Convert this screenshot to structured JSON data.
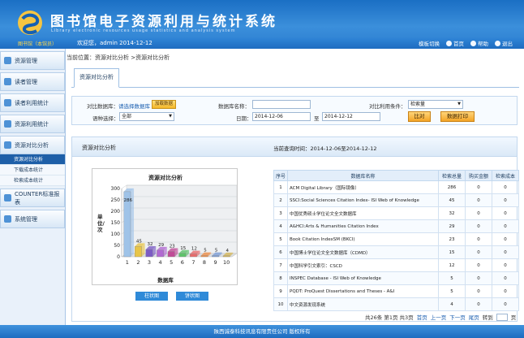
{
  "header": {
    "title": "图书馆电子资源利用与统计系统",
    "subtitle": "Library electronic resources usage statistics and analysis system",
    "user_role": "图书馆（本馆员）",
    "welcome": "欢迎您，admin   2014-12-12",
    "links": [
      {
        "label": "模板切换",
        "icon": "template-icon"
      },
      {
        "label": "首页",
        "icon": "home-icon"
      },
      {
        "label": "帮助",
        "icon": "help-icon"
      },
      {
        "label": "退出",
        "icon": "exit-icon"
      }
    ]
  },
  "sidebar": {
    "items": [
      {
        "label": "资源管理",
        "icon": "resource-icon"
      },
      {
        "label": "读者管理",
        "icon": "reader-icon"
      },
      {
        "label": "读者利用统计",
        "icon": "reader-stats-icon"
      },
      {
        "label": "资源利用统计",
        "icon": "resource-stats-icon"
      },
      {
        "label": "资源对比分析",
        "icon": "compare-icon"
      },
      {
        "label": "COUNTER标准报表",
        "icon": "report-icon"
      },
      {
        "label": "系统管理",
        "icon": "system-icon"
      }
    ],
    "sub_items": [
      "资源对比分析",
      "下载成本统计",
      "检索成本统计"
    ]
  },
  "breadcrumb": "当前位置：资源对比分析 >资源对比分析",
  "tab": "资源对比分析",
  "filter": {
    "db_label": "对比数据库：",
    "db_link": "请选择数据库",
    "db_button": "加载数据",
    "dbname_label": "数据库名称：",
    "condition_label": "对比利用条件：",
    "condition_value": "检索量",
    "lang_label": "语种选择：",
    "lang_value": "全部",
    "date_label": "日期：",
    "date_from": "2014-12-06",
    "date_to_label": "至",
    "date_to": "2014-12-12",
    "compare_button": "比对",
    "print_button": "数据打印"
  },
  "panel": {
    "title": "资源对比分析",
    "query_time": "当前查询时间：2014-12-06至2014-12-12",
    "bar_button": "柱状图",
    "pie_button": "饼状图"
  },
  "chart_data": {
    "type": "bar",
    "title": "资源对比分析",
    "xlabel": "数据库",
    "ylabel": "单位/次",
    "categories": [
      "1",
      "2",
      "3",
      "4",
      "5",
      "6",
      "7",
      "8",
      "9",
      "10"
    ],
    "values": [
      286,
      45,
      32,
      29,
      23,
      15,
      12,
      5,
      5,
      4
    ],
    "ylim": [
      0,
      300
    ],
    "yticks": [
      0,
      50,
      100,
      150,
      200,
      250,
      300
    ],
    "colors": [
      "#9fc3e8",
      "#e8c548",
      "#7c5cc4",
      "#b16ad2",
      "#c04c97",
      "#5fc36b",
      "#e86b6b",
      "#f0904a",
      "#7fa0d8",
      "#d7b85a"
    ],
    "grid": true,
    "legend": "none"
  },
  "table": {
    "headers": [
      "序号",
      "数据库名称",
      "检索总量",
      "购买金额",
      "检索成本"
    ],
    "rows": [
      [
        "1",
        "ACM Digital Library（国际镜像）",
        "286",
        "0",
        "0"
      ],
      [
        "2",
        "SSCI:Social Sciences Citation Index- ISI Web of Knowledge",
        "45",
        "0",
        "0"
      ],
      [
        "3",
        "中国优秀硕士学位论文全文数据库",
        "32",
        "0",
        "0"
      ],
      [
        "4",
        "A&HCI:Arts & Humanities Citation Index",
        "29",
        "0",
        "0"
      ],
      [
        "5",
        "Book Citation IndexSM (BKCI)",
        "23",
        "0",
        "0"
      ],
      [
        "6",
        "中国博士学位论文全文数据库（CDMD）",
        "15",
        "0",
        "0"
      ],
      [
        "7",
        "中国科学引文索引：CSCD",
        "12",
        "0",
        "0"
      ],
      [
        "8",
        "INSPEC Database - ISI Web of Knowledge",
        "5",
        "0",
        "0"
      ],
      [
        "9",
        "PQDT: ProQuest Dissertations and Theses - A&I",
        "5",
        "0",
        "0"
      ],
      [
        "10",
        "中文资源发现系统",
        "4",
        "0",
        "0"
      ]
    ]
  },
  "pager": {
    "summary": "共26条 第1页 共3页",
    "first": "首页",
    "prev": "上一页",
    "next": "下一页",
    "last": "尾页",
    "goto": "转到",
    "page_unit": "页"
  },
  "footer": "陕西诚泰科技讯息有限责任公司 版权所有"
}
